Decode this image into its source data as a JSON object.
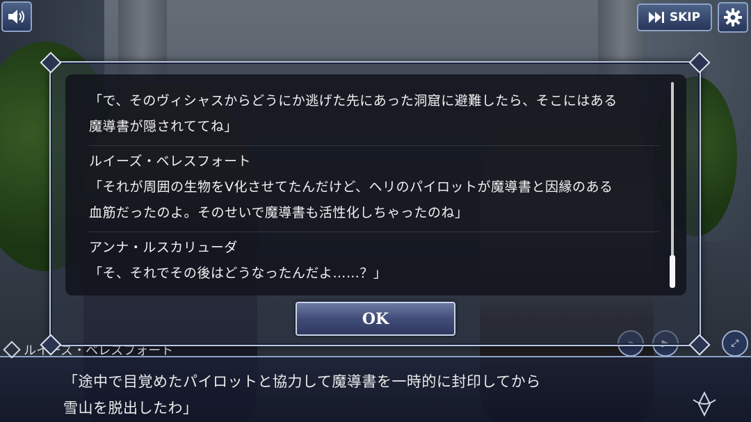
{
  "top_bar": {
    "skip_label": "SKIP"
  },
  "backlog": {
    "entries": [
      {
        "speaker": "",
        "lines": [
          "「で、そのヴィシャスからどうにか逃げた先にあった洞窟に避難したら、そこにはある",
          "魔導書が隠されててね」"
        ]
      },
      {
        "speaker": "ルイーズ・ベレスフォート",
        "lines": [
          "「それが周囲の生物をV化させてたんだけど、ヘリのパイロットが魔導書と因縁のある",
          "血筋だったのよ。そのせいで魔導書も活性化しちゃったのね」"
        ]
      },
      {
        "speaker": "アンナ・ルスカリューダ",
        "lines": [
          "「そ、それでその後はどうなったんだよ……？」"
        ]
      }
    ],
    "ok_label": "OK"
  },
  "message": {
    "speaker": "ルイーズ・ベレスフォート",
    "lines": [
      "「途中で目覚めたパイロットと協力して魔導書を一時的に封印してから",
      "雪山を脱出したわ」"
    ]
  }
}
